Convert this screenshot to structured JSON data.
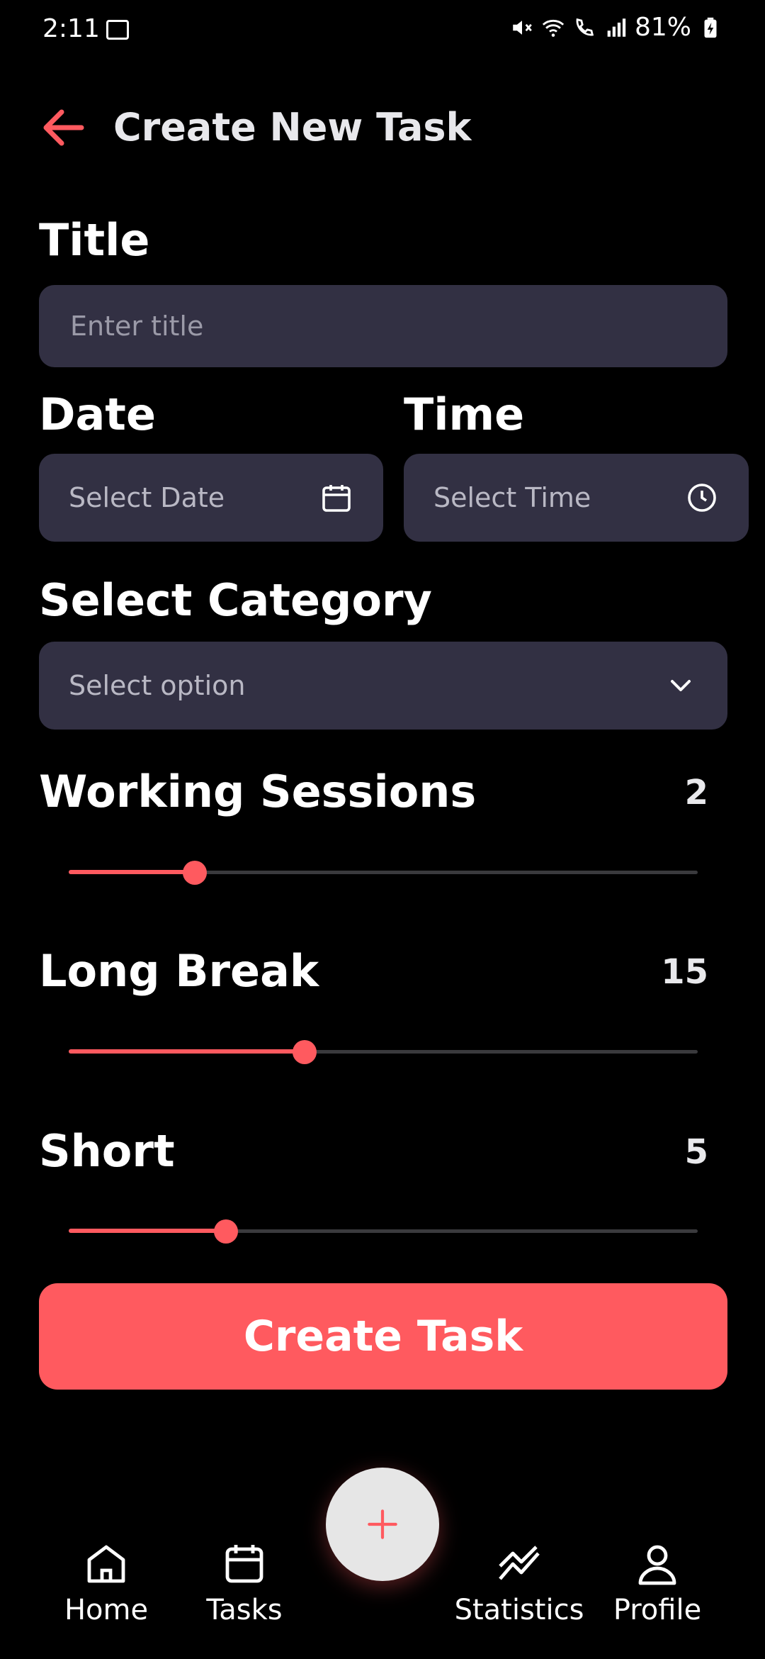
{
  "status_bar": {
    "time": "2:11",
    "battery": "81%"
  },
  "header": {
    "title": "Create New Task"
  },
  "form": {
    "title_label": "Title",
    "title_placeholder": "Enter title",
    "date_label": "Date",
    "date_placeholder": "Select Date",
    "time_label": "Time",
    "time_placeholder": "Select Time",
    "category_label": "Select Category",
    "category_selected": "Select option"
  },
  "sliders": [
    {
      "label": "Working Sessions",
      "value": "2",
      "fraction": 0.2
    },
    {
      "label": "Long Break",
      "value": "15",
      "fraction": 0.375
    },
    {
      "label": "Short",
      "value": "5",
      "fraction": 0.25
    }
  ],
  "create_button": "Create Task",
  "nav": {
    "home": "Home",
    "tasks": "Tasks",
    "statistics": "Statistics",
    "profile": "Profile"
  },
  "colors": {
    "accent": "#ff5a5f",
    "field_bg": "#323043",
    "background": "#000000"
  },
  "icons": [
    "back-arrow-icon",
    "calendar-icon",
    "clock-icon",
    "chevron-down-icon",
    "home-icon",
    "tasks-calendar-icon",
    "plus-icon",
    "statistics-icon",
    "profile-icon"
  ]
}
